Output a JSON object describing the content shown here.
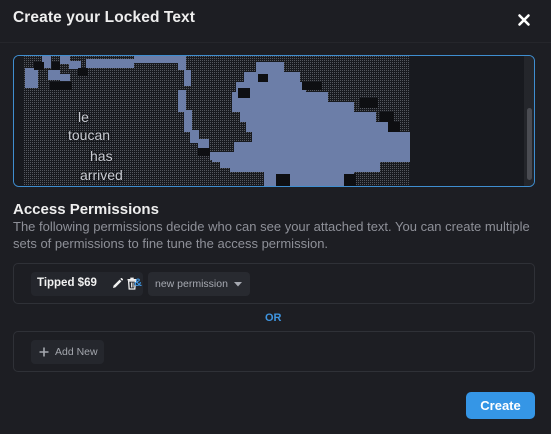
{
  "modal": {
    "title": "Create your Locked Text",
    "close_icon": "close-icon"
  },
  "locked_text": {
    "content_lines": [
      "le",
      "toucan",
      "has",
      "arrived"
    ],
    "border_color": "#3f8ed0",
    "art_color": "#6c7ea8"
  },
  "permissions": {
    "heading": "Access Permissions",
    "description": "The following permissions decide who can see your attached text. You can create multiple sets of permissions to fine tune the access permission.",
    "set_1": {
      "tag_label": "Tipped $69",
      "edit_icon": "pencil-icon",
      "delete_icon": "trash-icon",
      "conjunction": "&",
      "select_value": "new permission",
      "select_icon": "caret-down-icon"
    },
    "separator": "OR",
    "add_new_label": "Add New",
    "add_icon": "plus-icon"
  },
  "footer": {
    "create_label": "Create",
    "accent_color": "#3596e6"
  }
}
